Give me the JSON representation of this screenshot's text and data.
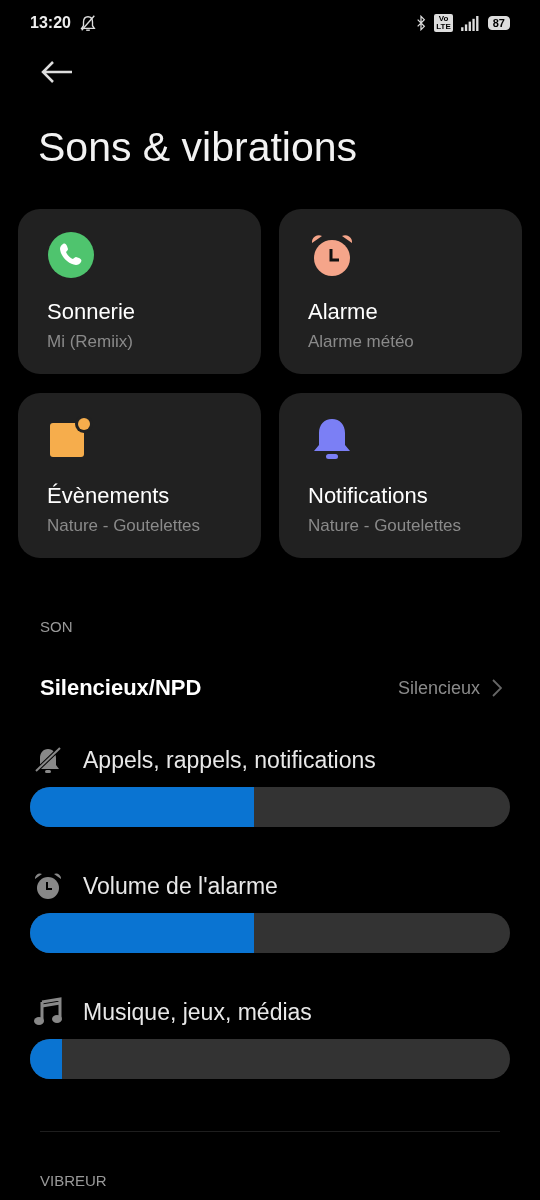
{
  "status_bar": {
    "time": "13:20",
    "network_badge": [
      "Vo",
      "LTE"
    ],
    "battery": "87"
  },
  "title": "Sons & vibrations",
  "cards": [
    {
      "kind": "phone",
      "title": "Sonnerie",
      "subtitle": "Mi (Remiix)"
    },
    {
      "kind": "alarm",
      "title": "Alarme",
      "subtitle": "Alarme météo"
    },
    {
      "kind": "event",
      "title": "Évènements",
      "subtitle": "Nature - Goutelettes"
    },
    {
      "kind": "bell",
      "title": "Notifications",
      "subtitle": "Nature - Goutelettes"
    }
  ],
  "sections": [
    {
      "header": "SON",
      "mode_row": {
        "label": "Silencieux/NPD",
        "value": "Silencieux"
      },
      "sliders": [
        {
          "kind": "bell-off",
          "label": "Appels, rappels, notifications",
          "level": 0.467
        },
        {
          "kind": "alarm",
          "label": "Volume de l'alarme",
          "level": 0.467
        },
        {
          "kind": "music",
          "label": "Musique, jeux, médias",
          "level": 0.067
        }
      ]
    },
    {
      "header": "VIBREUR"
    }
  ]
}
